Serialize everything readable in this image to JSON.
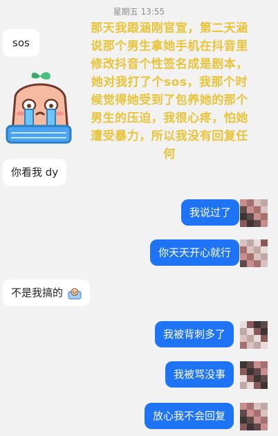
{
  "header": {
    "timestamp": "星期五 13:55"
  },
  "overlay_text": "那天我跟涵刚官宣，第二天涵说那个男生拿她手机在抖音里修改抖音个性签名成是剧本，她对我打了个sos，我那个时候觉得她受到了包养她的那个男生的压迫，我很心疼，怕她遭受暴力，所以我没有回复任何",
  "messages": {
    "left_1": "sos",
    "left_2": "你看我 dy",
    "left_3": "不是我搞的",
    "right_1": "我说过了",
    "right_2": "你天天开心就行",
    "right_3": "我被背刺多了",
    "right_4": "我被骂没事",
    "right_5": "放心我不会回复"
  },
  "icons": {
    "sticker": "crying-radish-sticker-icon",
    "emoji": "pouting-face-emoji-icon"
  },
  "colors": {
    "background": "#f2f2f2",
    "left_bubble": "#ffffff",
    "right_bubble": "#1e74f5",
    "overlay_text": "#e9c53a"
  }
}
